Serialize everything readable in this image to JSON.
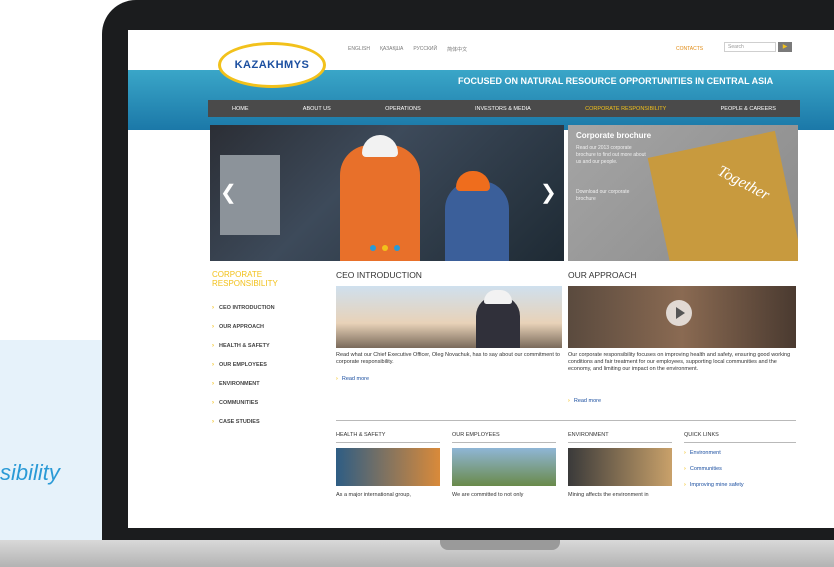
{
  "background_text": "sibility",
  "site": {
    "logo_text": "KAZAKHMYS",
    "languages": [
      "ENGLISH",
      "ҚАЗАҚША",
      "РУССКИЙ",
      "简体中文"
    ],
    "contacts_label": "CONTACTS",
    "search_placeholder": "Search",
    "tagline": "FOCUSED ON NATURAL RESOURCE OPPORTUNITIES IN CENTRAL ASIA",
    "nav": [
      "HOME",
      "ABOUT US",
      "OPERATIONS",
      "INVESTORS & MEDIA",
      "CORPORATE RESPONSIBILITY",
      "PEOPLE & CAREERS"
    ],
    "active_nav": "CORPORATE RESPONSIBILITY",
    "brochure": {
      "title": "Corporate brochure",
      "text": "Read our 2013 corporate brochure to find out more about us and our people.",
      "download": "Download our corporate brochure",
      "cover_word": "Together"
    },
    "sidebar": {
      "title_line1": "CORPORATE",
      "title_line2": "RESPONSIBILITY",
      "items": [
        "CEO INTRODUCTION",
        "OUR APPROACH",
        "HEALTH & SAFETY",
        "OUR EMPLOYEES",
        "ENVIRONMENT",
        "COMMUNITIES",
        "CASE STUDIES"
      ]
    },
    "ceo": {
      "title": "CEO INTRODUCTION",
      "text": "Read what our Chief Executive Officer, Oleg Novachuk, has to say about our commitment to corporate responsibility.",
      "read_more": "Read more"
    },
    "approach": {
      "title": "OUR APPROACH",
      "text": "Our corporate responsibility focuses on improving health and safety, ensuring good working conditions and fair treatment for our employees, supporting local communities and the economy, and limiting our impact on the environment.",
      "read_more": "Read more"
    },
    "bottom": {
      "health_title": "HEALTH & SAFETY",
      "health_text": "As a major international group,",
      "employees_title": "OUR EMPLOYEES",
      "employees_text": "We are committed to not only",
      "environment_title": "ENVIRONMENT",
      "environment_text": "Mining affects the environment in",
      "quicklinks_title": "QUICK LINKS",
      "quicklinks": [
        "Environment",
        "Communities",
        "Improving mine safety"
      ]
    }
  }
}
